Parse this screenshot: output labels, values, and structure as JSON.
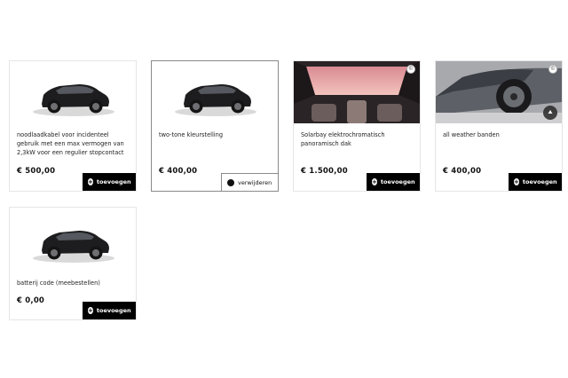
{
  "options": [
    {
      "description": "noodlaadkabel voor incidenteel gebruik met een max vermogen van 2,3kW voor een regulier stopcontact",
      "price": "€ 500,00",
      "button_label": "toevoegen",
      "image": "car-thumbnail"
    },
    {
      "description": "two-tone kleurstelling",
      "price": "€ 400,00",
      "button_label": "verwijderen",
      "image": "car-thumbnail",
      "selected": true
    },
    {
      "description": "Solarbay elektrochromatisch panoramisch dak",
      "price": "€ 1.500,00",
      "button_label": "toevoegen",
      "image": "panoramic-roof-photo"
    },
    {
      "description": "all weather banden",
      "price": "€ 400,00",
      "button_label": "toevoegen",
      "image": "wheel-photo"
    },
    {
      "description": "batterij code (meebestellen)",
      "price": "€ 0,00",
      "button_label": "toevoegen",
      "image": "car-thumbnail"
    }
  ],
  "colors": {
    "button_bg": "#000000",
    "card_border": "#e6e6e6",
    "selected_border": "#8a8a8a"
  }
}
